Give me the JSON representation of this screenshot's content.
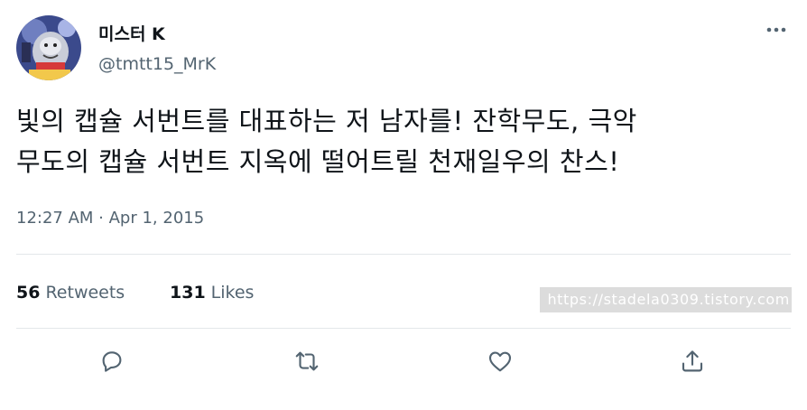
{
  "user": {
    "display_name": "미스터 K",
    "handle": "@tmtt15_MrK"
  },
  "tweet": {
    "text_line1": "빛의 캡슐 서번트를 대표하는 저 남자를! 잔학무도, 극악",
    "text_line2": "무도의 캡슐 서번트 지옥에 떨어트릴 천재일우의 찬스!",
    "timestamp": "12:27 AM · Apr 1, 2015"
  },
  "stats": {
    "retweets_count": "56",
    "retweets_label": "Retweets",
    "likes_count": "131",
    "likes_label": "Likes"
  },
  "watermark": "https://stadela0309.tistory.com",
  "icons": {
    "more": "more-icon",
    "reply": "reply-icon",
    "retweet": "retweet-icon",
    "like": "like-icon",
    "share": "share-icon"
  },
  "colors": {
    "text": "#0f1419",
    "secondary": "#536471",
    "divider": "#e3e7ea"
  }
}
